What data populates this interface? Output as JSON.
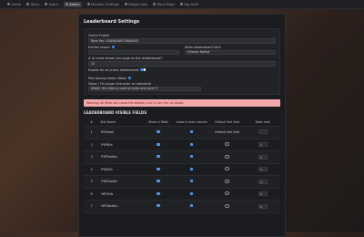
{
  "nav": {
    "items": [
      {
        "label": "Home",
        "icon": "home-icon"
      },
      {
        "label": "Discs",
        "icon": "disc-icon"
      },
      {
        "label": "Users",
        "icon": "users-icon"
      },
      {
        "label": "Admin",
        "icon": "gear-icon"
      },
      {
        "label": "Member Settings",
        "icon": "settings-icon"
      },
      {
        "label": "Badge Lists",
        "icon": "list-icon"
      },
      {
        "label": "Race Maps",
        "icon": "map-icon"
      },
      {
        "label": "Big Stuff",
        "icon": "star-icon"
      }
    ],
    "active_index": 3
  },
  "panel": {
    "title": "Leaderboard Settings",
    "section": {
      "cache_label": "Cache Enable",
      "cache_value": "Race Yes: LEADBOARD ENABLED",
      "entries_label": "Entries shown",
      "entries_value": "",
      "allow_label": "Allow leaderboard html",
      "allow_value": "Choose: Native",
      "page_label": "# of races shown per page on the leaderboard?",
      "page_value": "10",
      "public_label": "Enable for all public leaderboard",
      "badge_label": "Play backup team ribbon",
      "video_label": "Video / I'd (upper character on standard)",
      "video_value": "ANote: the video is used as index and cover Y"
    },
    "warning": "Warning: All fields will cause the sidebar, but 12 per line, to reload.",
    "fields_title": "LEADERBOARD VISIBLE FIELDS",
    "table": {
      "headers": [
        "#",
        "Stat Name",
        "Show in Table",
        "show in main column",
        "Default Sort Stat",
        "Table rank"
      ],
      "rows": [
        {
          "n": "1",
          "name": "RFDataS",
          "show": true,
          "main": true,
          "sort": "Default Sort Stat",
          "rank": ""
        },
        {
          "n": "2",
          "name": "PVPKills",
          "show": true,
          "main": true,
          "sort": "",
          "rank": "1"
        },
        {
          "n": "3",
          "name": "PVPDeaths",
          "show": true,
          "main": true,
          "sort": "",
          "rank": "2"
        },
        {
          "n": "4",
          "name": "PVEKills",
          "show": true,
          "main": true,
          "sort": "",
          "rank": "3"
        },
        {
          "n": "5",
          "name": "PVEDeaths",
          "show": true,
          "main": true,
          "sort": "",
          "rank": "4"
        },
        {
          "n": "6",
          "name": "NPCKills",
          "show": true,
          "main": true,
          "sort": "",
          "rank": "5"
        },
        {
          "n": "7",
          "name": "NPCDeaths",
          "show": true,
          "main": true,
          "sort": "",
          "rank": "6"
        }
      ]
    }
  }
}
